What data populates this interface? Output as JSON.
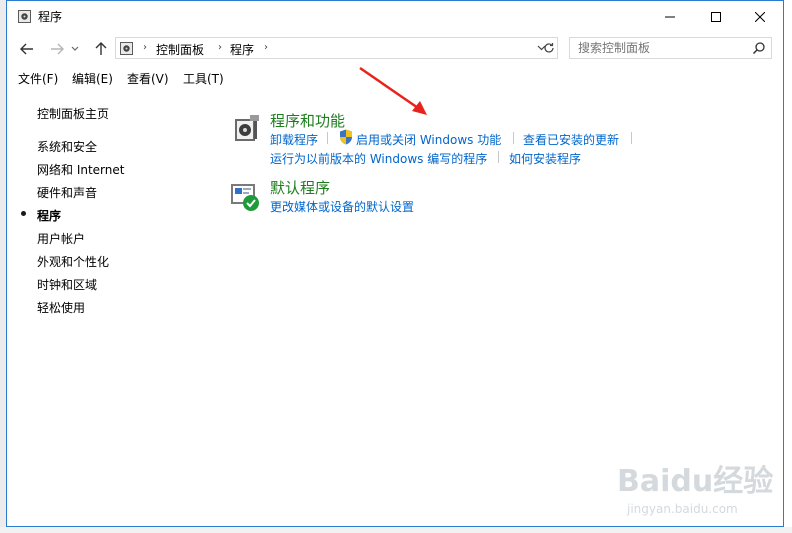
{
  "window": {
    "title": "程序"
  },
  "address_bar": {
    "breadcrumbs": [
      "控制面板",
      "程序"
    ]
  },
  "search": {
    "placeholder": "搜索控制面板"
  },
  "menu": [
    "文件(F)",
    "编辑(E)",
    "查看(V)",
    "工具(T)"
  ],
  "sidebar": {
    "home": "控制面板主页",
    "items": [
      {
        "label": "系统和安全",
        "current": false
      },
      {
        "label": "网络和 Internet",
        "current": false
      },
      {
        "label": "硬件和声音",
        "current": false
      },
      {
        "label": "程序",
        "current": true
      },
      {
        "label": "用户帐户",
        "current": false
      },
      {
        "label": "外观和个性化",
        "current": false
      },
      {
        "label": "时钟和区域",
        "current": false
      },
      {
        "label": "轻松使用",
        "current": false
      }
    ]
  },
  "categories": [
    {
      "title": "程序和功能",
      "icon": "programs-features-icon",
      "links": [
        "卸载程序",
        "启用或关闭 Windows 功能",
        "查看已安装的更新",
        "运行为以前版本的 Windows 编写的程序",
        "如何安装程序"
      ]
    },
    {
      "title": "默认程序",
      "icon": "default-programs-icon",
      "links": [
        "更改媒体或设备的默认设置"
      ]
    }
  ],
  "colors": {
    "accent_border": "#2b7bd0",
    "category_title": "#1e7e1e",
    "link": "#0066cc",
    "annotation_arrow": "#e8231c"
  },
  "watermark": {
    "logo": "Baidu经验",
    "url": "jingyan.baidu.com"
  }
}
